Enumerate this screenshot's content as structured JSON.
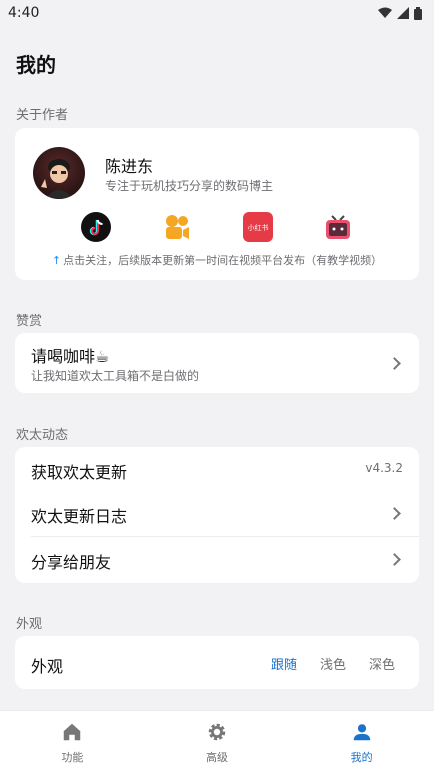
{
  "status_bar": {
    "time": "4:40"
  },
  "page_title": "我的",
  "sections": {
    "about": "关于作者",
    "reward": "赞赏",
    "updates": "欢太动态",
    "appearance": "外观"
  },
  "author": {
    "name": "陈进东",
    "description": "专注于玩机技巧分享的数码博主",
    "note": "点击关注，后续版本更新第一时间在视频平台发布（有教学视频）",
    "social_icons": [
      "douyin-icon",
      "kuaishou-icon",
      "xiaohongshu-icon",
      "bilibili-icon"
    ],
    "xiaohongshu_label": "小红书"
  },
  "reward": {
    "title": "请喝咖啡☕",
    "subtitle": "让我知道欢太工具箱不是白做的"
  },
  "updates": {
    "get_update": "获取欢太更新",
    "version": "v4.3.2",
    "changelog": "欢太更新日志",
    "share": "分享给朋友"
  },
  "appearance": {
    "label": "外观",
    "options": [
      "跟随",
      "浅色",
      "深色"
    ],
    "selected": "跟随"
  },
  "bottom_nav": {
    "items": [
      {
        "label": "功能",
        "icon": "home-icon"
      },
      {
        "label": "高级",
        "icon": "gear-icon"
      },
      {
        "label": "我的",
        "icon": "person-icon"
      }
    ],
    "active": "我的"
  },
  "colors": {
    "accent": "#1b73c9",
    "background": "#f2f2f4"
  }
}
